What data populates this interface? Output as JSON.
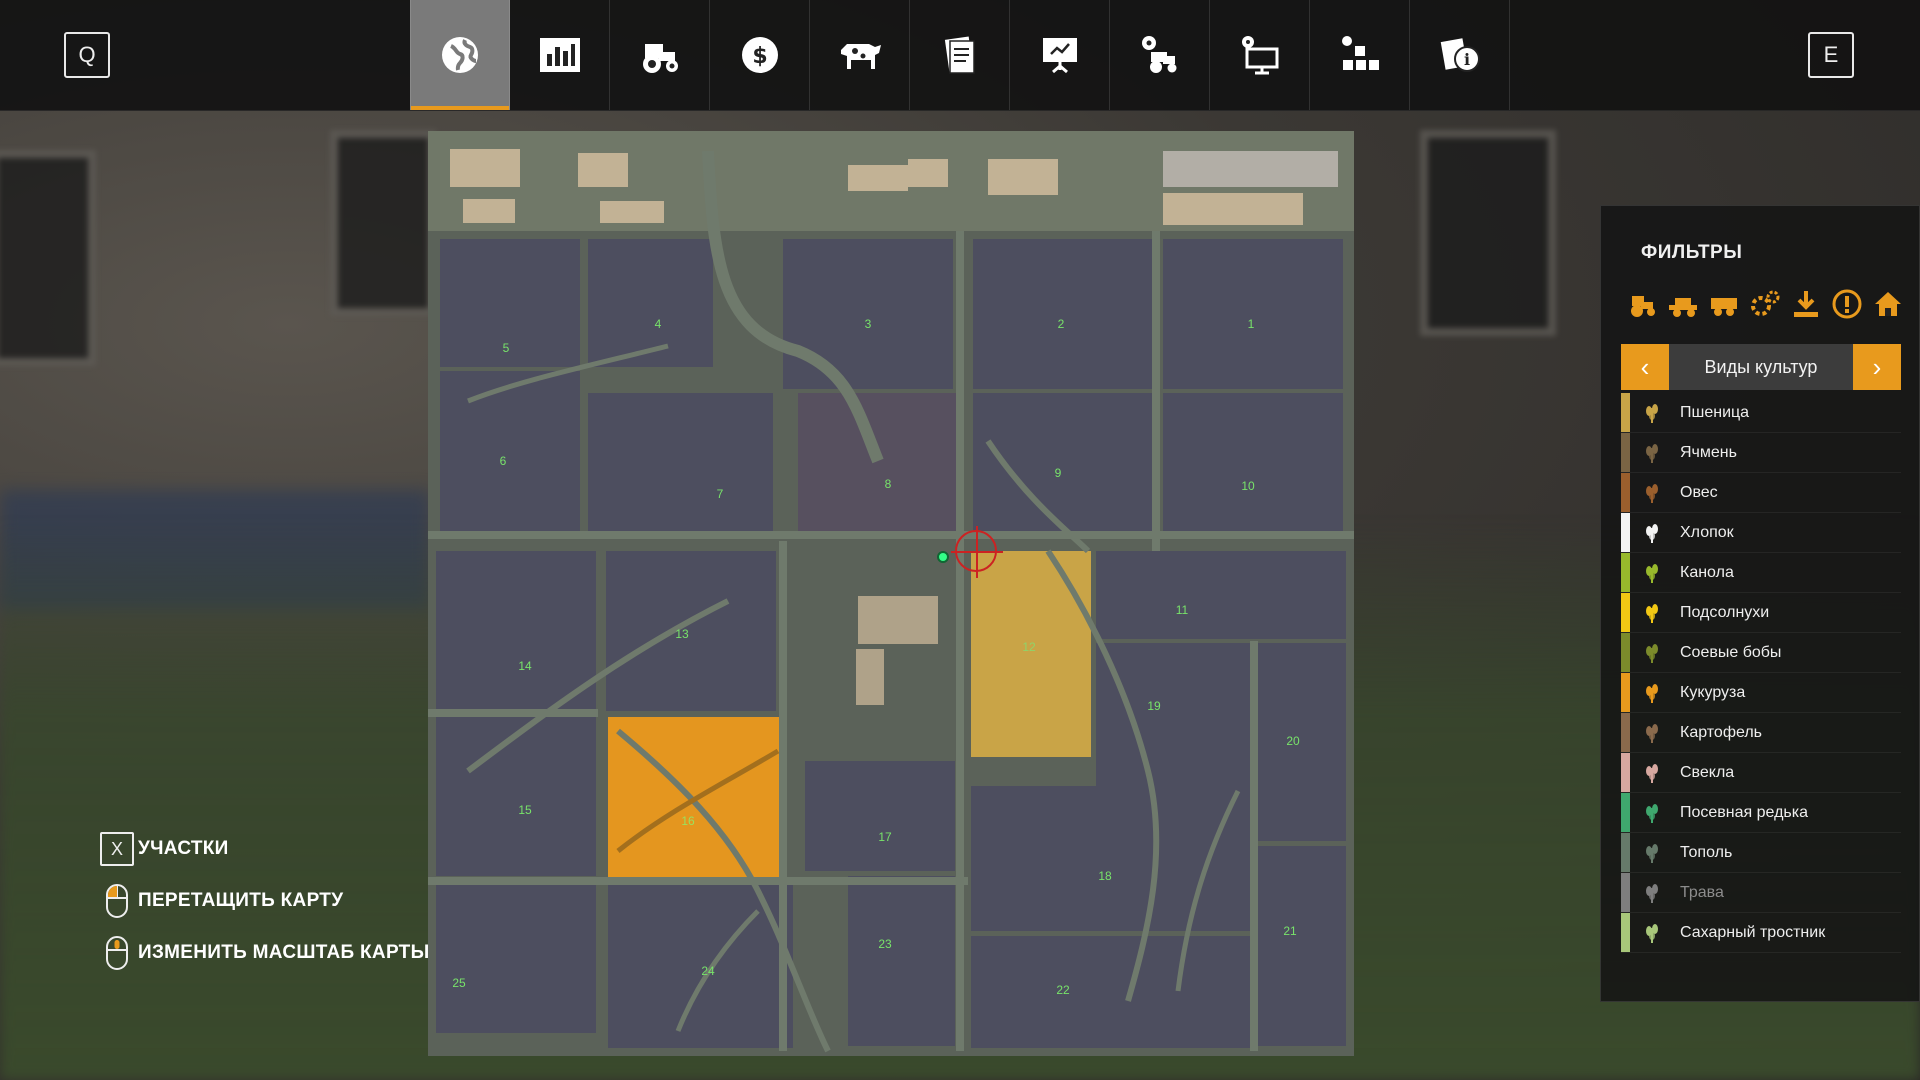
{
  "hotkeys": {
    "left": "Q",
    "right": "E"
  },
  "tabs": [
    {
      "icon": "globe-icon",
      "active": true
    },
    {
      "icon": "statistics-icon",
      "active": false
    },
    {
      "icon": "tractor-icon",
      "active": false
    },
    {
      "icon": "dollar-icon",
      "active": false
    },
    {
      "icon": "cow-icon",
      "active": false
    },
    {
      "icon": "contracts-icon",
      "active": false
    },
    {
      "icon": "presentation-icon",
      "active": false
    },
    {
      "icon": "vehicle-settings-icon",
      "active": false
    },
    {
      "icon": "monitor-settings-icon",
      "active": false
    },
    {
      "icon": "tiles-icon",
      "active": false
    },
    {
      "icon": "info-icon",
      "active": false
    }
  ],
  "filters": {
    "title": "ФИЛЬТРЫ",
    "icons": [
      "tractor-icon",
      "harvester-icon",
      "trailer-icon",
      "tools-icon",
      "download-icon",
      "warning-icon",
      "home-icon"
    ],
    "selector": {
      "label": "Виды культур",
      "prev": "‹",
      "next": "›"
    },
    "crops": [
      {
        "label": "Пшеница",
        "color": "#c8a447",
        "icon": "wheat-icon"
      },
      {
        "label": "Ячмень",
        "color": "#7a6444",
        "icon": "barley-icon"
      },
      {
        "label": "Овес",
        "color": "#9b5f2d",
        "icon": "oat-icon"
      },
      {
        "label": "Хлопок",
        "color": "#f3f3f3",
        "icon": "cotton-icon"
      },
      {
        "label": "Канола",
        "color": "#98b92c",
        "icon": "canola-icon"
      },
      {
        "label": "Подсолнухи",
        "color": "#f2c814",
        "icon": "sunflower-icon"
      },
      {
        "label": "Соевые бобы",
        "color": "#7c8b2b",
        "icon": "soybean-icon"
      },
      {
        "label": "Кукуруза",
        "color": "#e89a1d",
        "icon": "corn-icon"
      },
      {
        "label": "Картофель",
        "color": "#8a6a4c",
        "icon": "potato-icon"
      },
      {
        "label": "Свекла",
        "color": "#d7a8a0",
        "icon": "beet-icon"
      },
      {
        "label": "Посевная редька",
        "color": "#3fa86e",
        "icon": "radish-icon"
      },
      {
        "label": "Тополь",
        "color": "#667a6a",
        "icon": "poplar-icon"
      },
      {
        "label": "Трава",
        "color": "#7e7e7e",
        "icon": "grass-icon",
        "dim": true
      },
      {
        "label": "Сахарный тростник",
        "color": "#a8c77a",
        "icon": "sugarcane-icon"
      }
    ]
  },
  "legend": [
    {
      "key": "X",
      "label": "УЧАСТКИ"
    },
    {
      "mouse": "mouse-left-icon",
      "label": "ПЕРЕТАЩИТЬ КАРТУ"
    },
    {
      "mouse": "mouse-wheel-icon",
      "label": "ИЗМЕНИТЬ МАСШТАБ КАРТЫ"
    }
  ],
  "map": {
    "fields": [
      "1",
      "2",
      "3",
      "4",
      "5",
      "6",
      "7",
      "8",
      "9",
      "10",
      "11",
      "12",
      "13",
      "14",
      "15",
      "16",
      "17",
      "18",
      "19",
      "20",
      "21",
      "22",
      "23",
      "24",
      "25"
    ]
  }
}
